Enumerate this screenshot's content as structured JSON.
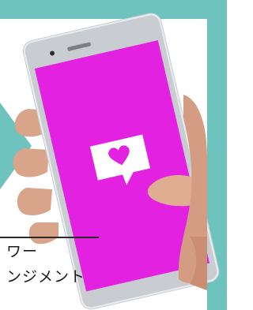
{
  "caption": {
    "line1": "ワー",
    "line2": "ンジメント"
  },
  "icons": {
    "notification": "heart-speech-bubble-icon"
  },
  "colors": {
    "teal": "#6fc3be",
    "screen": "#e321e0",
    "phone_body": "#c9cdd1"
  }
}
